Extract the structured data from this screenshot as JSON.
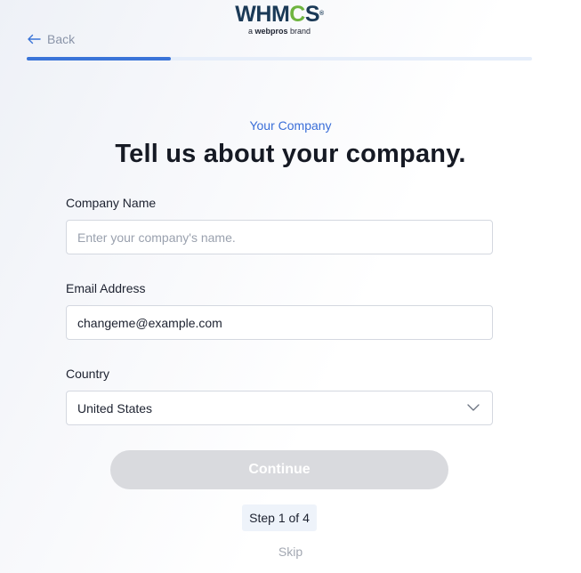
{
  "brand": {
    "logo_text_a": "WHM",
    "logo_text_cog": "C",
    "logo_text_b": "S",
    "logo_registered": "®",
    "tagline_prefix": "a ",
    "tagline_brand": "webpros",
    "tagline_suffix": " brand"
  },
  "nav": {
    "back_label": "Back",
    "back_icon": "arrow-left-icon"
  },
  "progress": {
    "current_step": 1,
    "total_steps": 4,
    "fill_fraction": 0.285
  },
  "page": {
    "eyebrow": "Your Company",
    "heading": "Tell us about your company."
  },
  "form": {
    "company_name": {
      "label": "Company Name",
      "value": "",
      "placeholder": "Enter your company's name."
    },
    "email": {
      "label": "Email Address",
      "value": "changeme@example.com"
    },
    "country": {
      "label": "Country",
      "selected": "United States",
      "icon": "chevron-down-icon"
    }
  },
  "actions": {
    "continue_label": "Continue",
    "step_text": "Step 1 of 4",
    "skip_label": "Skip"
  },
  "colors": {
    "accent": "#3a74d8",
    "eyebrow": "#3a6ed8",
    "button_disabled": "#d9dade",
    "logo_navy": "#1b3a57",
    "logo_green": "#6eb43f"
  }
}
